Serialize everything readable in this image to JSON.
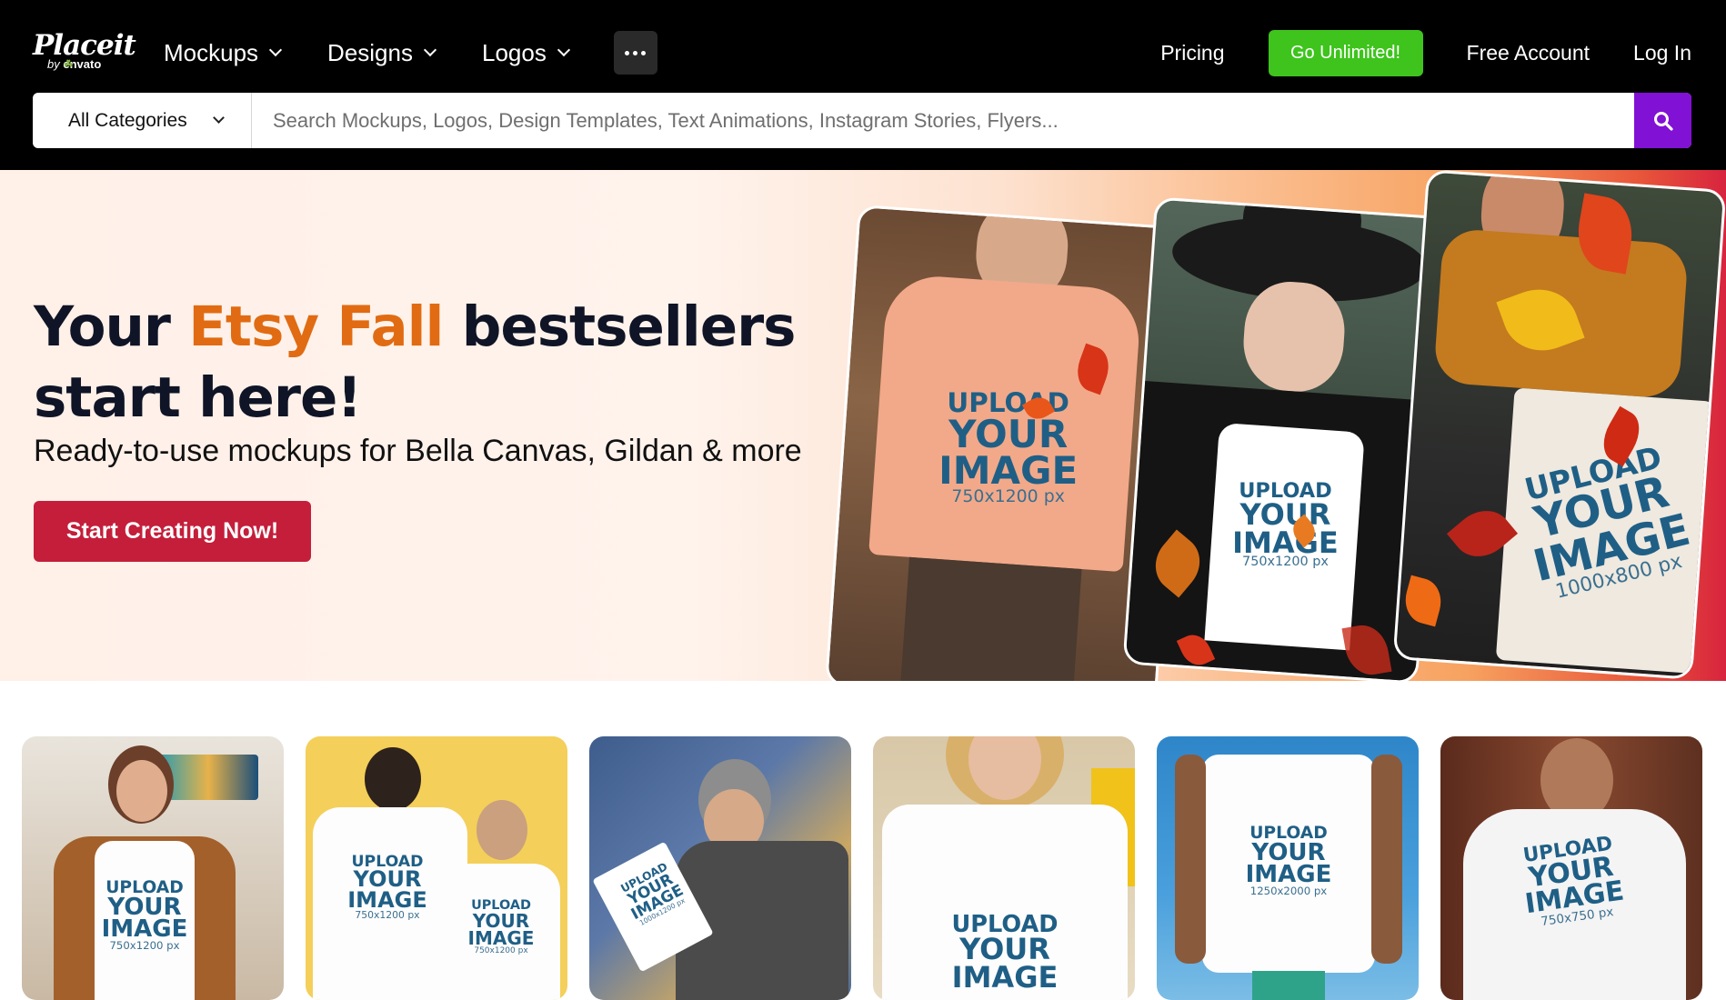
{
  "logo": {
    "brand": "Placeit",
    "by": "by",
    "parent": "envato"
  },
  "nav": {
    "items": [
      {
        "label": "Mockups"
      },
      {
        "label": "Designs"
      },
      {
        "label": "Logos"
      }
    ],
    "more_icon": "ellipsis-icon",
    "pricing": "Pricing",
    "go_unlimited": "Go Unlimited!",
    "free_account": "Free Account",
    "log_in": "Log In"
  },
  "search": {
    "category": "All Categories",
    "placeholder": "Search Mockups, Logos, Design Templates, Text Animations, Instagram Stories, Flyers...",
    "button_icon": "search-icon"
  },
  "hero": {
    "title_pre": "Your ",
    "title_accent": "Etsy Fall",
    "title_post": " bestsellers",
    "title_line2": "start here!",
    "subtitle": "Ready-to-use mockups for Bella Canvas, Gildan & more",
    "cta": "Start Creating Now!",
    "cards": [
      {
        "upload": "UPLOAD",
        "your": "YOUR",
        "image": "IMAGE",
        "size": "750x1200 px"
      },
      {
        "upload": "UPLOAD",
        "your": "YOUR",
        "image": "IMAGE",
        "size": "750x1200 px"
      },
      {
        "upload": "UPLOAD",
        "your": "YOUR",
        "image": "IMAGE",
        "size": "1000x800 px"
      }
    ]
  },
  "thumbnails": [
    {
      "upload": "UPLOAD",
      "your": "YOUR",
      "image": "IMAGE",
      "size": "750x1200 px"
    },
    {
      "upload": "UPLOAD",
      "your": "YOUR",
      "image": "IMAGE",
      "size": "750x1200 px"
    },
    {
      "upload": "UPLOAD",
      "your": "YOUR",
      "image": "IMAGE",
      "size": "1000x1200 px"
    },
    {
      "upload": "UPLOAD",
      "your": "YOUR",
      "image": "IMAGE",
      "size": ""
    },
    {
      "upload": "UPLOAD",
      "your": "YOUR",
      "image": "IMAGE",
      "size": "1250x2000 px"
    },
    {
      "upload": "UPLOAD",
      "your": "YOUR",
      "image": "IMAGE",
      "size": "750x750 px"
    }
  ],
  "colors": {
    "accent_orange": "#e16b12",
    "cta_red": "#c41e3a",
    "unlimited_green": "#3ec41c",
    "search_purple": "#8111d4"
  }
}
